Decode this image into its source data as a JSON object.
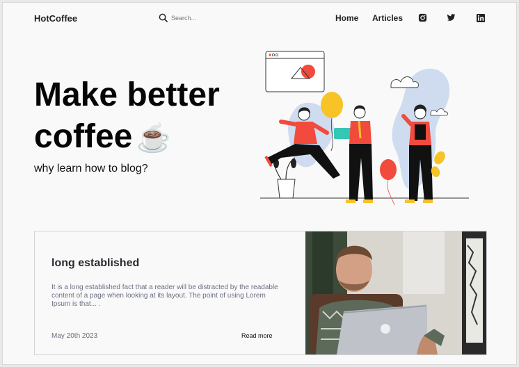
{
  "nav": {
    "brand": "HotCoffee",
    "search_placeholder": "Search...",
    "links": [
      "Home",
      "Articles"
    ],
    "social_icons": [
      "instagram-icon",
      "twitter-icon",
      "linkedin-icon"
    ]
  },
  "hero": {
    "title_line1": "Make better",
    "title_line2": "coffee",
    "cup_emoji": "☕",
    "subtitle": "why learn how to blog?"
  },
  "card": {
    "title": "long established",
    "excerpt": "It is a long established fact that a reader will be distracted by the readable content of a page when looking at its layout. The point of using Lorem Ipsum is that... .",
    "date": "May 20th 2023",
    "read_more": "Read more"
  },
  "colors": {
    "accent_red": "#f24a3c",
    "accent_yellow": "#f7c326",
    "accent_blue": "#cfdcf0",
    "teal": "#35c7b5",
    "text_muted": "#6b6e80"
  }
}
